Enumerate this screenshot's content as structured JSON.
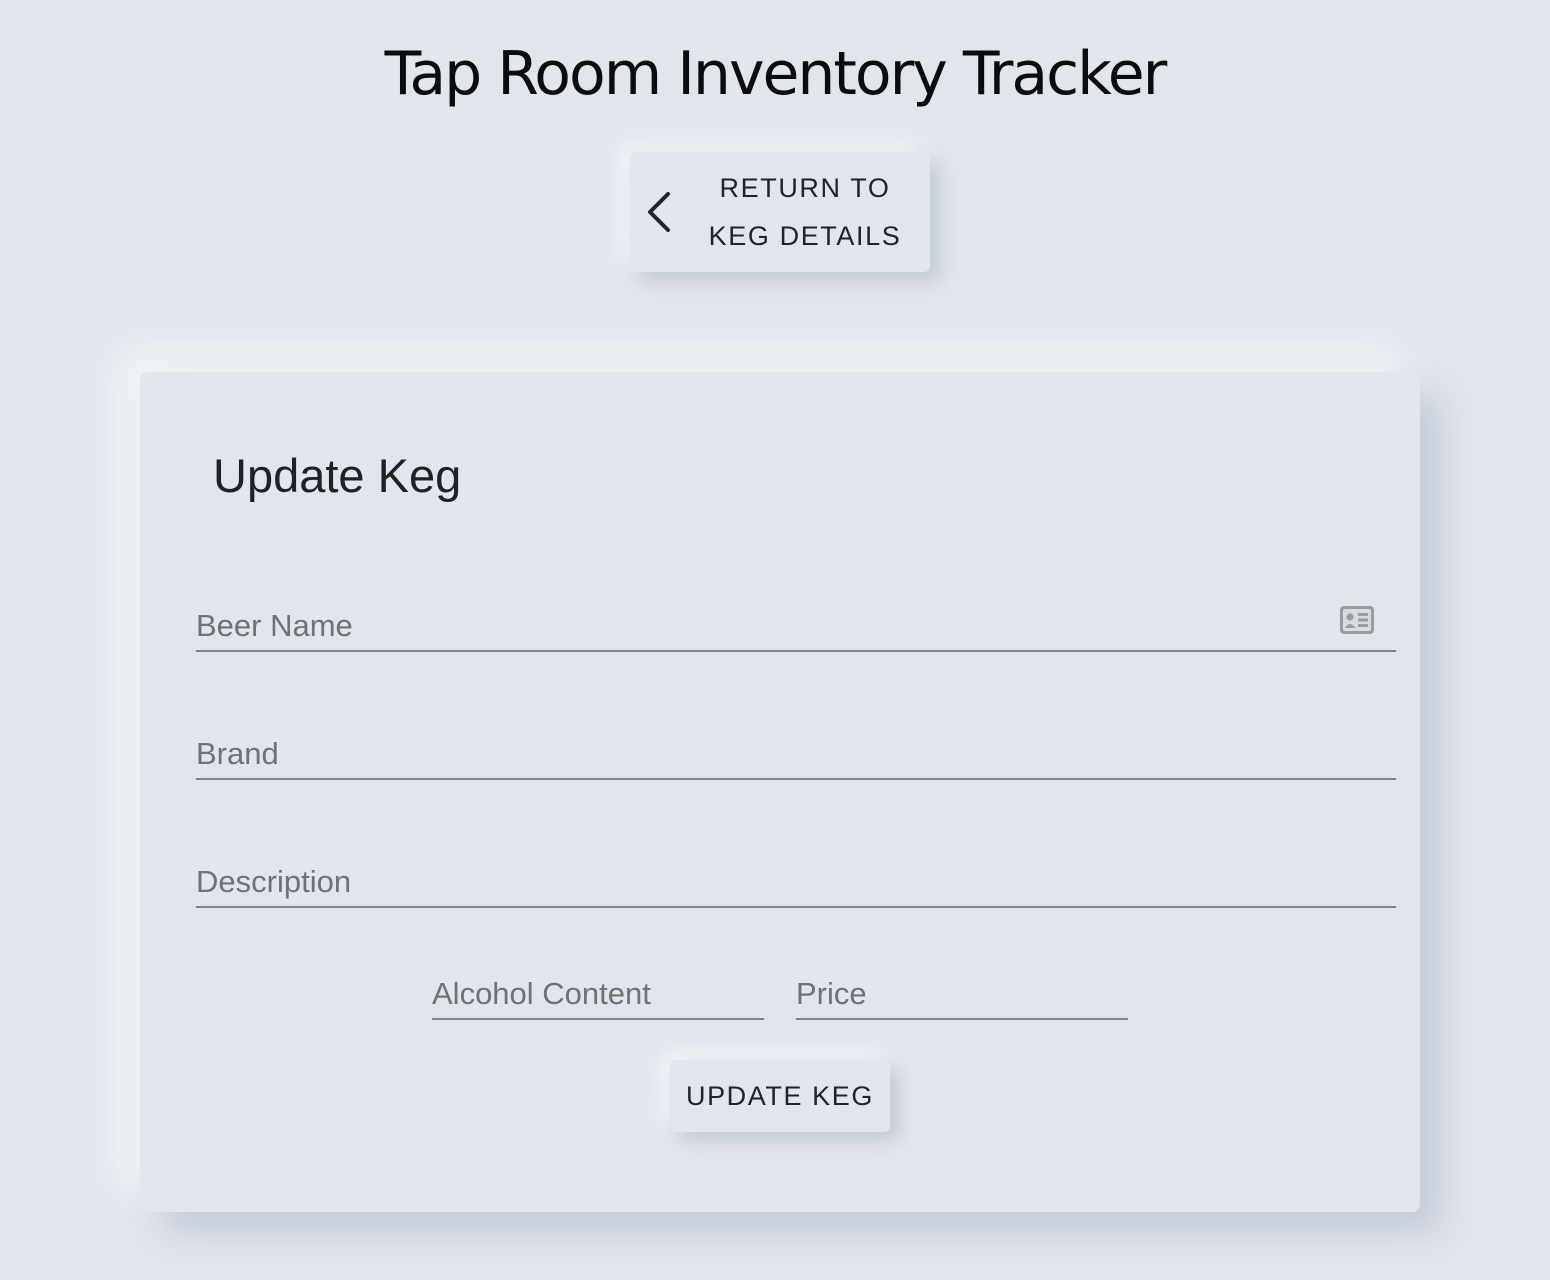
{
  "app": {
    "title": "Tap Room Inventory Tracker"
  },
  "nav": {
    "return_line1": "RETURN TO",
    "return_line2": "KEG DETAILS",
    "return_icon": "chevron-left-icon"
  },
  "form": {
    "title": "Update Keg",
    "fields": {
      "beer_name": {
        "placeholder": "Beer Name",
        "value": "",
        "icon": "id-card-icon"
      },
      "brand": {
        "placeholder": "Brand",
        "value": ""
      },
      "description": {
        "placeholder": "Description",
        "value": ""
      },
      "alcohol_content": {
        "placeholder": "Alcohol Content",
        "value": ""
      },
      "price": {
        "placeholder": "Price",
        "value": ""
      }
    },
    "submit_label": "UPDATE KEG"
  },
  "colors": {
    "background": "#e1e5ec",
    "text": "#1e2126",
    "placeholder": "#6e7175",
    "underline": "#7f8287",
    "icon": "#9a9c9f"
  }
}
